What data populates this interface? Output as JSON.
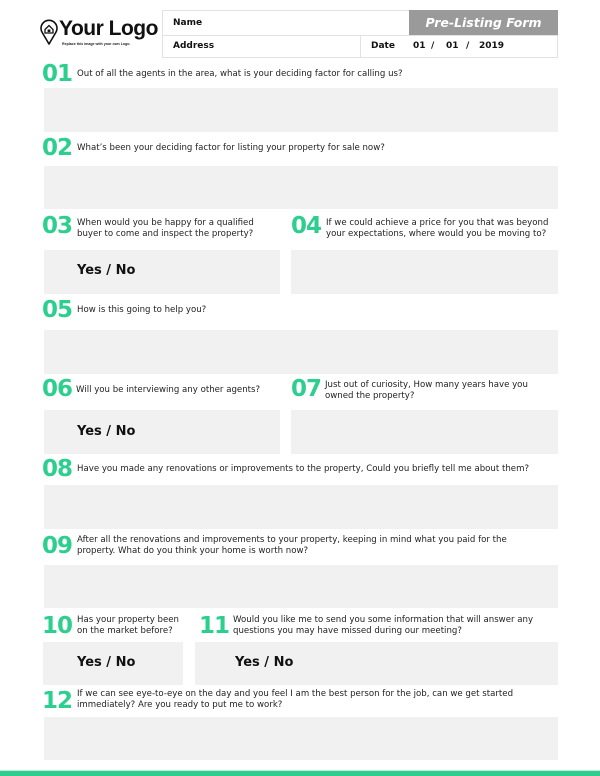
{
  "logo": {
    "icon": "map-pin-house-icon",
    "text": "Your Logo",
    "subtitle": "Replace this image with your own Logo."
  },
  "header": {
    "title": "Pre-Listing Form",
    "name_label": "Name",
    "name_value": "",
    "address_label": "Address",
    "address_value": "",
    "date_label": "Date",
    "date": {
      "day": "01",
      "month": "01",
      "year": "2019",
      "separator": "/"
    }
  },
  "colors": {
    "accent": "#2dcf8f",
    "answer_box": "#f1f1f1",
    "title_bg": "#9a9a9a"
  },
  "questions": [
    {
      "number": "01",
      "text": "Out of all the agents in the area, what is your deciding factor for calling us?",
      "answer": ""
    },
    {
      "number": "02",
      "text": "What’s been your deciding factor for listing your property for sale now?",
      "answer": ""
    },
    {
      "number": "03",
      "text_line1": "When would you be happy for a qualified",
      "text_line2": "buyer to come and inspect the property?",
      "answer": "Yes / No"
    },
    {
      "number": "04",
      "text_line1": "If we could achieve a price for you that was beyond",
      "text_line2": "your expectations, where would you be moving to?",
      "answer": ""
    },
    {
      "number": "05",
      "text": "How is this going to help you?",
      "answer": ""
    },
    {
      "number": "06",
      "text": "Will you be interviewing any other agents?",
      "answer": "Yes / No"
    },
    {
      "number": "07",
      "text_line1": "Just out of curiosity, How many years have you",
      "text_line2": "owned the property?",
      "answer": ""
    },
    {
      "number": "08",
      "text": "Have you made any renovations or improvements to the property, Could you briefly tell me about them?",
      "answer": ""
    },
    {
      "number": "09",
      "text_line1": "After all the renovations and improvements to your property, keeping in mind what you paid for the",
      "text_line2": "property. What do you think your home is worth now?",
      "answer": ""
    },
    {
      "number": "10",
      "text_line1": "Has your property been",
      "text_line2": "on the market before?",
      "answer": "Yes / No"
    },
    {
      "number": "11",
      "text_line1": "Would you like me to send you some information that will answer any",
      "text_line2": "questions you may have missed during our meeting?",
      "answer": "Yes / No"
    },
    {
      "number": "12",
      "text_line1": "If we can see eye-to-eye on the day and you feel I am the best person for the job, can we get started",
      "text_line2": "immediately? Are you ready to put me to work?",
      "answer": ""
    }
  ]
}
